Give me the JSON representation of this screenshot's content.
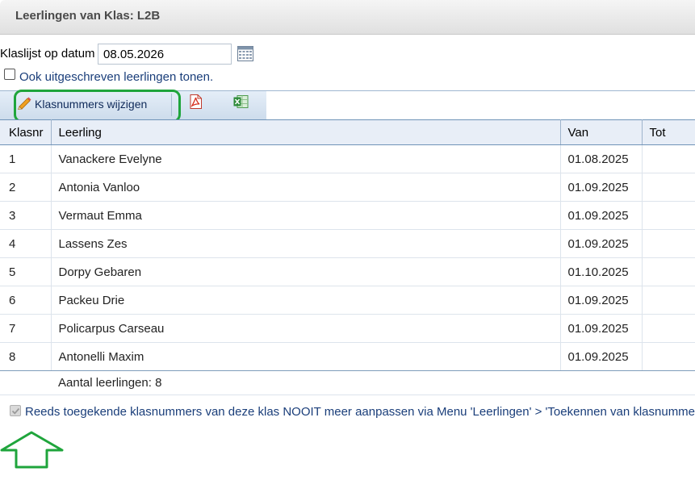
{
  "window": {
    "title": "Leerlingen van Klas: L2B"
  },
  "filter": {
    "date_label": "Klaslijst op datum",
    "date_value": "08.05.2026",
    "show_unsubscribed_label": "Ook uitgeschreven leerlingen tonen."
  },
  "toolbar": {
    "edit_numbers_label": "Klasnummers wijzigen",
    "edit_icon": "pencil-icon",
    "pdf_icon": "pdf-icon",
    "excel_icon": "excel-icon"
  },
  "table": {
    "columns": [
      "Klasnr",
      "Leerling",
      "Van",
      "Tot"
    ],
    "rows": [
      {
        "nr": "1",
        "name": "Vanackere Evelyne",
        "from": "01.08.2025",
        "to": ""
      },
      {
        "nr": "2",
        "name": "Antonia Vanloo",
        "from": "01.09.2025",
        "to": ""
      },
      {
        "nr": "3",
        "name": "Vermaut Emma",
        "from": "01.09.2025",
        "to": ""
      },
      {
        "nr": "4",
        "name": "Lassens Zes",
        "from": "01.09.2025",
        "to": ""
      },
      {
        "nr": "5",
        "name": "Dorpy Gebaren",
        "from": "01.10.2025",
        "to": ""
      },
      {
        "nr": "6",
        "name": "Packeu Drie",
        "from": "01.09.2025",
        "to": ""
      },
      {
        "nr": "7",
        "name": "Policarpus Carseau",
        "from": "01.09.2025",
        "to": ""
      },
      {
        "nr": "8",
        "name": "Antonelli Maxim",
        "from": "01.09.2025",
        "to": ""
      }
    ],
    "footer": "Aantal leerlingen: 8"
  },
  "lock_notice": {
    "checked": true,
    "label": "Reeds toegekende klasnummers van deze klas NOOIT meer aanpassen via Menu 'Leerlingen' > 'Toekennen van klasnummers'"
  },
  "annotations": {
    "highlight_color": "#1fa53c",
    "arrow_color": "#1fa53c"
  }
}
